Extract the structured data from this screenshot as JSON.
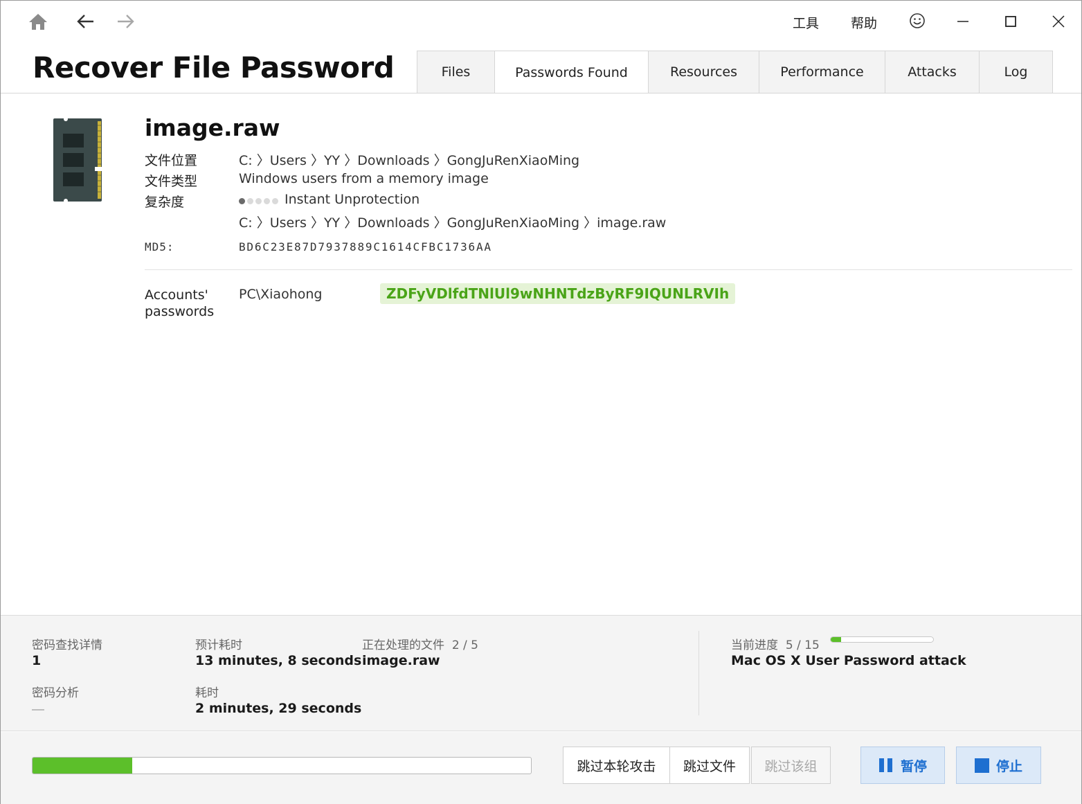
{
  "menu": {
    "tools": "工具",
    "help": "帮助"
  },
  "app": {
    "title": "Recover File Password"
  },
  "tabs": [
    {
      "label": "Files"
    },
    {
      "label": "Passwords Found"
    },
    {
      "label": "Resources"
    },
    {
      "label": "Performance"
    },
    {
      "label": "Attacks"
    },
    {
      "label": "Log"
    }
  ],
  "file": {
    "name": "image.raw",
    "location_label": "文件位置",
    "location": "C: 〉Users 〉YY 〉Downloads 〉GongJuRenXiaoMing",
    "type_label": "文件类型",
    "type": "Windows users from a memory image",
    "complexity_label": "复杂度",
    "complexity_level": 1,
    "complexity_max": 5,
    "complexity": "Instant Unprotection",
    "full_path": "C: 〉Users 〉YY 〉Downloads 〉GongJuRenXiaoMing 〉image.raw",
    "md5_label": "MD5:",
    "md5": "BD6C23E87D7937889C1614CFBC1736AA"
  },
  "accounts": {
    "label": "Accounts' passwords",
    "account": "PC\\Xiaohong",
    "password": "ZDFyVDlfdTNlUl9wNHNTdzByRF9IQUNLRVIh"
  },
  "stats": {
    "found_label": "密码查找详情",
    "found_value": "1",
    "analysis_label": "密码分析",
    "est_label": "预计耗时",
    "est_value": "13 minutes, 8 seconds",
    "elapsed_label": "耗时",
    "elapsed_value": "2 minutes, 29 seconds",
    "processing_label": "正在处理的文件",
    "processing_count": "2 / 5",
    "processing_value": "image.raw",
    "progress_label": "当前进度",
    "progress_count": "5 / 15",
    "progress_fraction": 0.1,
    "attack_value": "Mac OS X User Password attack"
  },
  "overall_progress": 0.2,
  "buttons": {
    "skip_round": "跳过本轮攻击",
    "skip_file": "跳过文件",
    "skip_group": "跳过该组",
    "pause": "暂停",
    "stop": "停止"
  },
  "colors": {
    "accent_green": "#5cbf2a",
    "password_green": "#4aa418",
    "button_blue": "#1e6fd0"
  }
}
